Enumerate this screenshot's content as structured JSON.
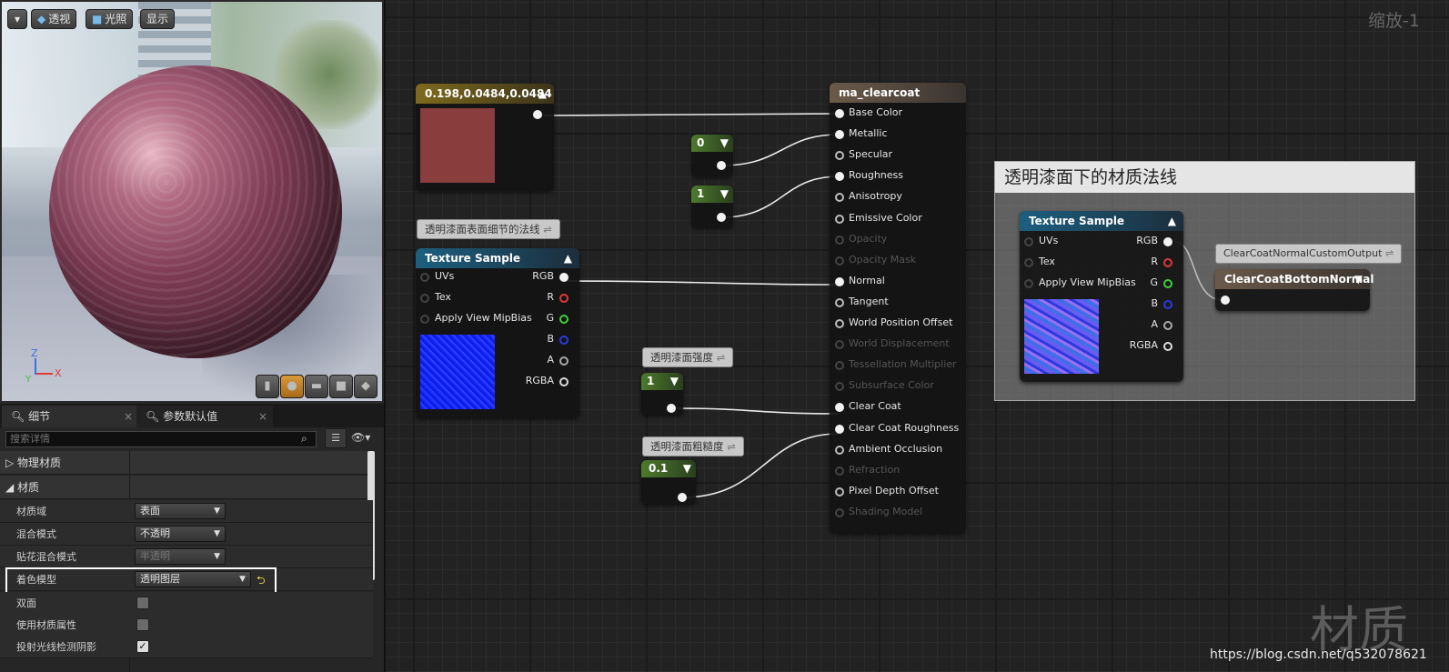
{
  "viewport": {
    "buttons": {
      "dropdown": "▾",
      "perspective": "透视",
      "lighting": "光照",
      "show": "显示"
    },
    "axis": {
      "z": "Z",
      "y": "Y",
      "x": "X"
    }
  },
  "details": {
    "tabs": {
      "details": "细节",
      "params": "参数默认值"
    },
    "search_placeholder": "搜索详情",
    "categories": {
      "physical": "物理材质",
      "material": "材质"
    },
    "rows": [
      {
        "label": "材质域",
        "value": "表面"
      },
      {
        "label": "混合模式",
        "value": "不透明"
      },
      {
        "label": "贴花混合模式",
        "value": "半透明"
      },
      {
        "label": "着色模型",
        "value": "透明图层"
      },
      {
        "label": "双面",
        "checked": false
      },
      {
        "label": "使用材质属性",
        "checked": false
      },
      {
        "label": "投射光线检测阴影",
        "checked": true
      }
    ]
  },
  "graph": {
    "zoom": "缩放-1",
    "watermark": "材质",
    "url": "https://blog.csdn.net/q532078621",
    "const3": {
      "title": "0.198,0.0484,0.0484",
      "color": "#8a3d3d"
    },
    "c0": "0",
    "c1": "1",
    "cstrength": "1",
    "crough": "0.1",
    "comments": {
      "normal": "透明漆面表面细节的法线",
      "strength": "透明漆面强度",
      "rough": "透明漆面粗糙度",
      "output": "ClearCoatNormalCustomOutput",
      "group": "透明漆面下的材质法线"
    },
    "tex1": {
      "title": "Texture Sample",
      "inputs": [
        "UVs",
        "Tex",
        "Apply View MipBias"
      ],
      "outputs": [
        "RGB",
        "R",
        "G",
        "B",
        "A",
        "RGBA"
      ]
    },
    "tex2": {
      "title": "Texture Sample",
      "inputs": [
        "UVs",
        "Tex",
        "Apply View MipBias"
      ],
      "outputs": [
        "RGB",
        "R",
        "G",
        "B",
        "A",
        "RGBA"
      ]
    },
    "ccbn": {
      "title": "ClearCoatBottomNormal"
    },
    "material": {
      "title": "ma_clearcoat",
      "pins": [
        {
          "label": "Base Color",
          "on": true
        },
        {
          "label": "Metallic",
          "on": true
        },
        {
          "label": "Specular",
          "on": false
        },
        {
          "label": "Roughness",
          "on": true
        },
        {
          "label": "Anisotropy",
          "on": false
        },
        {
          "label": "Emissive Color",
          "on": false
        },
        {
          "label": "Opacity",
          "dis": true
        },
        {
          "label": "Opacity Mask",
          "dis": true
        },
        {
          "label": "Normal",
          "on": true
        },
        {
          "label": "Tangent",
          "on": false
        },
        {
          "label": "World Position Offset",
          "on": false
        },
        {
          "label": "World Displacement",
          "dis": true
        },
        {
          "label": "Tessellation Multiplier",
          "dis": true
        },
        {
          "label": "Subsurface Color",
          "dis": true
        },
        {
          "label": "Clear Coat",
          "on": true
        },
        {
          "label": "Clear Coat Roughness",
          "on": true
        },
        {
          "label": "Ambient Occlusion",
          "on": false
        },
        {
          "label": "Refraction",
          "dis": true
        },
        {
          "label": "Pixel Depth Offset",
          "on": false
        },
        {
          "label": "Shading Model",
          "dis": true
        }
      ]
    }
  }
}
